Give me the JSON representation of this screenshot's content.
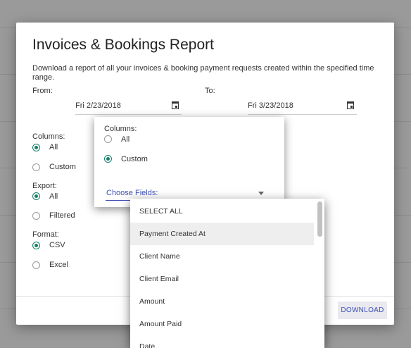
{
  "dialog": {
    "title": "Invoices & Bookings Report",
    "description": "Download a report of all your invoices & booking payment requests created within the specified time range.",
    "from_label": "From:",
    "to_label": "To:",
    "from_date": "Fri 2/23/2018",
    "to_date": "Fri 3/23/2018",
    "columns_label": "Columns:",
    "columns_all": "All",
    "columns_custom": "Custom",
    "export_label": "Export:",
    "export_all": "All",
    "export_filtered": "Filtered",
    "format_label": "Format:",
    "format_csv": "CSV",
    "format_excel": "Excel",
    "download_label": "DOWNLOAD"
  },
  "popup": {
    "columns_label": "Columns:",
    "all": "All",
    "custom": "Custom",
    "choose_placeholder": "Choose Fields:"
  },
  "fields_list": {
    "items": [
      "SELECT ALL",
      "Payment Created At",
      "Client Name",
      "Client Email",
      "Amount",
      "Amount Paid",
      "Date"
    ],
    "highlighted": "Payment Created At"
  },
  "icons": [
    "calendar-icon",
    "dropdown-caret-icon"
  ],
  "colors": {
    "accent_teal": "#15806b",
    "accent_blue": "#3f51b5"
  }
}
